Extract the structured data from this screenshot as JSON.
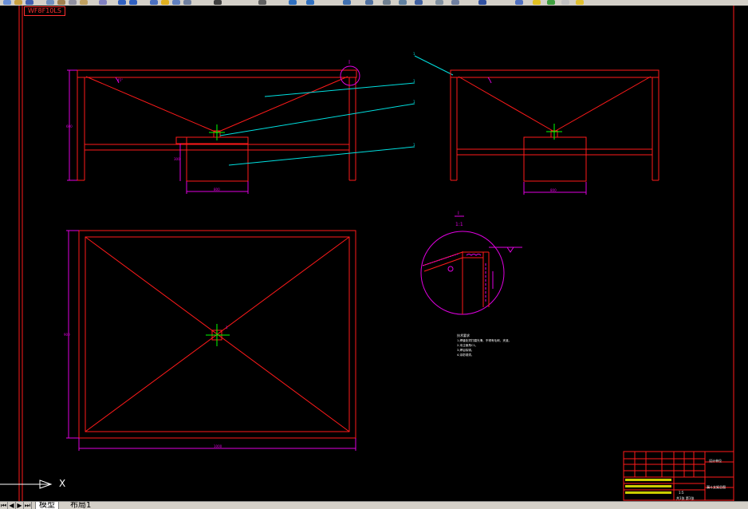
{
  "window": {
    "drawing_tab_label": "WF8F10LS",
    "toolbar_icons": [
      "new-icon",
      "open-icon",
      "save-icon",
      "print-icon",
      "cut-icon",
      "copy-icon",
      "paste-icon",
      "match-prop-icon",
      "undo-icon",
      "redo-icon",
      "pan-icon",
      "zoom-realtime-icon",
      "zoom-window-icon",
      "zoom-previous-icon",
      "properties-icon",
      "design-center-icon",
      "tool-palette-icon",
      "sheet-set-icon",
      "markup-icon",
      "calc-icon",
      "layer-icon",
      "help-icon"
    ]
  },
  "drawing": {
    "annotation_1": "1",
    "annotation_2": "1",
    "annotation_3": "1",
    "annotation_4": "1",
    "annotation_5": "1",
    "detail_marker": "I",
    "detail_label_top": "I",
    "detail_label_bottom": "1:1",
    "dim_front_width": "800",
    "dim_side_width": "800",
    "dim_plan_width": "1000",
    "dim_plan_height": "900",
    "dim_front_height": "600",
    "dim_sub_height": "300",
    "angle_label": "45°"
  },
  "notes": {
    "title": "技术要求",
    "lines": [
      "1.焊缝处须打磨光滑，不得有毛刺、夹渣。",
      "2.未注倒角C1。",
      "3.焊后除锈。",
      "4.涂防锈漆。"
    ]
  },
  "title_block": {
    "drawing_name": "漏斗支架总图",
    "company": "设计单位",
    "scale": "1:5",
    "sheet": "共1张 第1张"
  },
  "tabs": {
    "nav_first": "⏮",
    "nav_prev": "◀",
    "nav_next": "▶",
    "nav_last": "⏭",
    "model": "模型",
    "layout1": "布局1"
  },
  "colors": {
    "background": "#000000",
    "outline": "#ff1a1a",
    "dimension": "#e000e0",
    "leader": "#00e0e0",
    "center": "#00ff00",
    "text": "#ffffff"
  }
}
